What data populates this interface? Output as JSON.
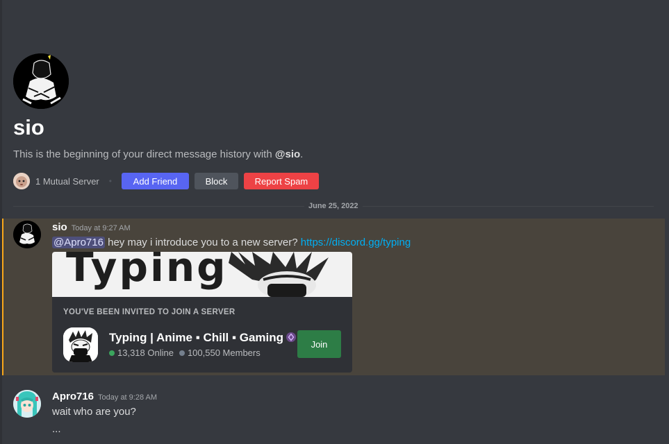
{
  "profile": {
    "name": "sio",
    "intro_prefix": "This is the beginning of your direct message history with ",
    "intro_handle": "@sio",
    "intro_suffix": ".",
    "mutual_servers": "1 Mutual Server"
  },
  "actions": {
    "add_friend": "Add Friend",
    "block": "Block",
    "report_spam": "Report Spam"
  },
  "divider": {
    "date": "June 25, 2022"
  },
  "messages": [
    {
      "author": "sio",
      "timestamp": "Today at 9:27 AM",
      "mention": "@Apro716",
      "text": " hey may i introduce you to a new server? ",
      "link": "https://discord.gg/typing",
      "highlighted": true,
      "invite": {
        "banner_text": "Typing",
        "heading": "YOU'VE BEEN INVITED TO JOIN A SERVER",
        "server_name": "Typing | Anime ▪ Chill ▪ Gaming",
        "online": "13,318 Online",
        "members": "100,550 Members",
        "join_label": "Join"
      }
    },
    {
      "author": "Apro716",
      "timestamp": "Today at 9:28 AM",
      "lines": [
        "wait who are you?",
        "..."
      ]
    }
  ],
  "colors": {
    "background": "#36393f",
    "blurple": "#5865f2",
    "danger": "#ed4245",
    "highlight_border": "#faa81a",
    "join_green": "#2d7d46",
    "link": "#00aff4"
  }
}
